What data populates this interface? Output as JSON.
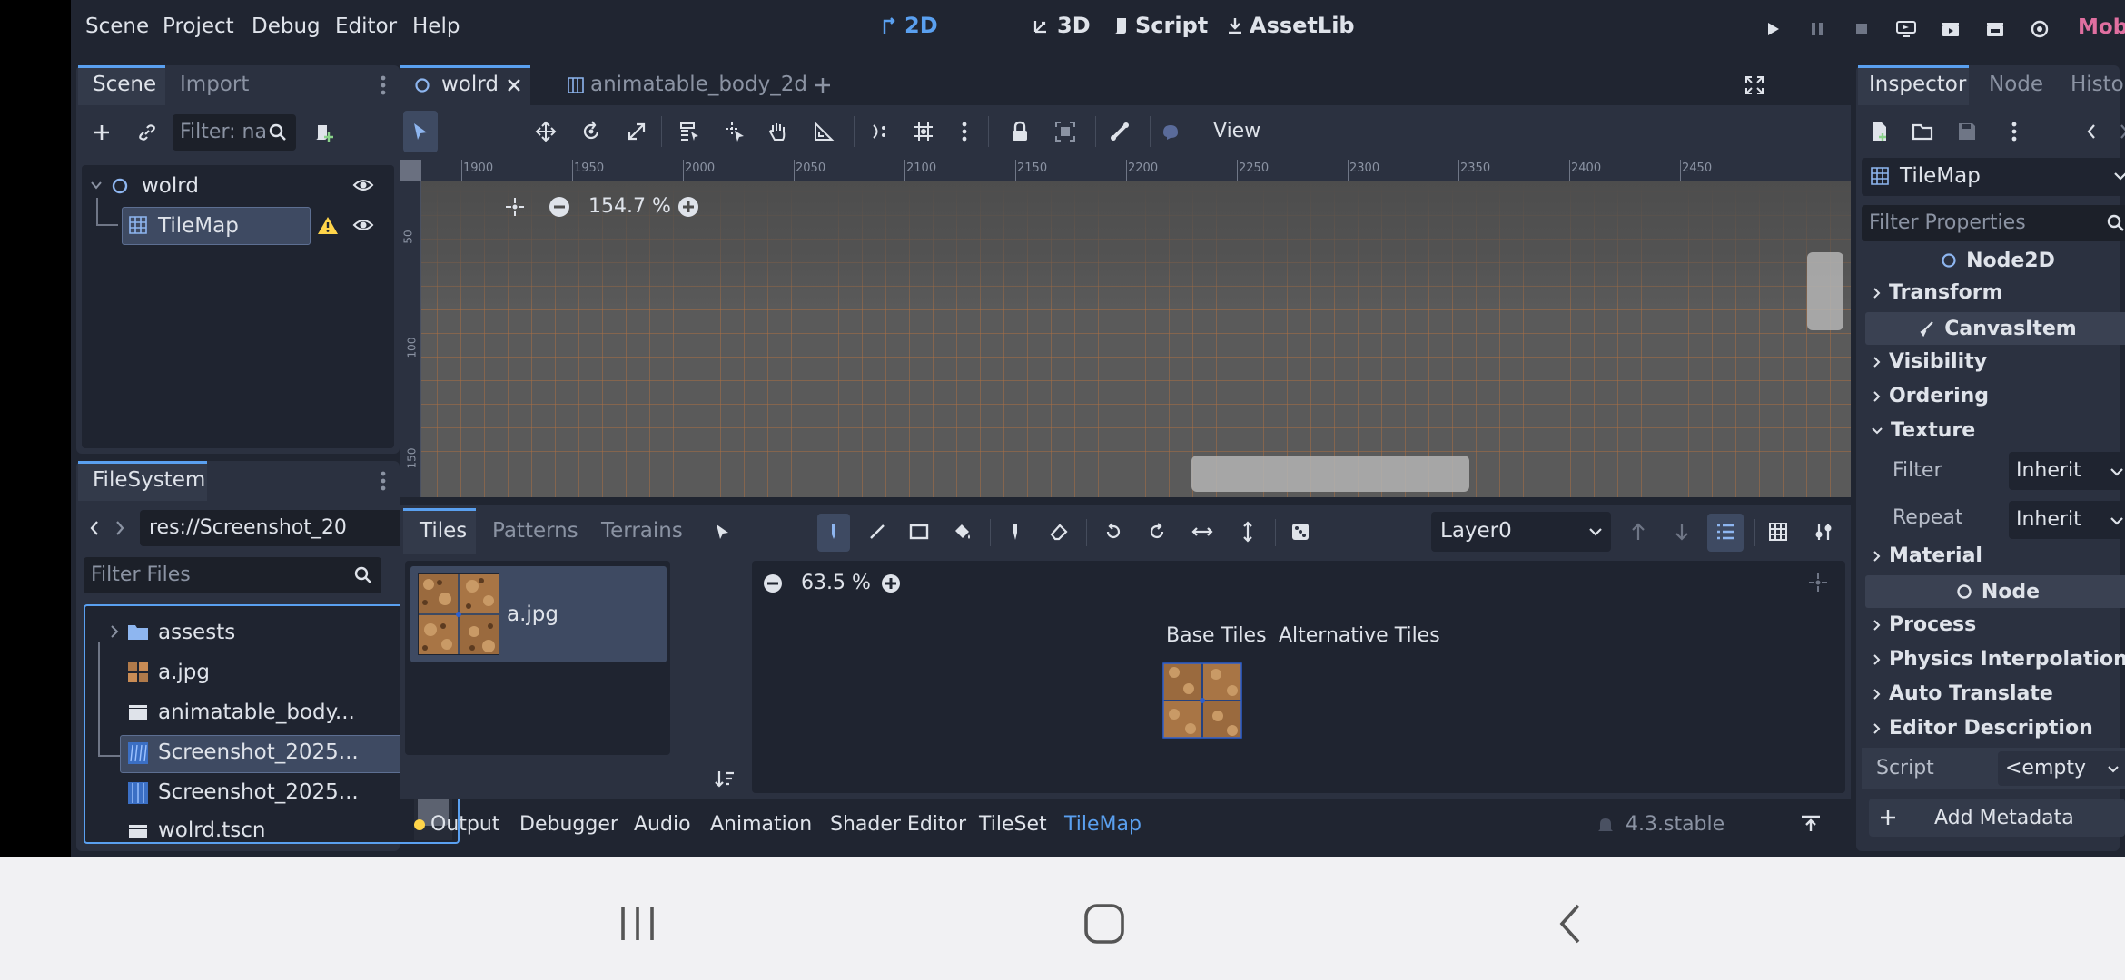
{
  "menu": [
    "Scene",
    "Project",
    "Debug",
    "Editor",
    "Help"
  ],
  "workspaces": [
    {
      "label": "2D",
      "active": true
    },
    {
      "label": "3D",
      "active": false
    },
    {
      "label": "Script",
      "active": false
    },
    {
      "label": "AssetLib",
      "active": false
    }
  ],
  "renderer": "Mobile",
  "scene_dock": {
    "tabs": [
      "Scene",
      "Import"
    ],
    "filter_placeholder": "Filter: na",
    "tree": [
      {
        "label": "wolrd",
        "type": "node2d"
      },
      {
        "label": "TileMap",
        "type": "tilemap",
        "selected": true
      }
    ]
  },
  "filesystem": {
    "title": "FileSystem",
    "path": "res://Screenshot_20",
    "filter_placeholder": "Filter Files",
    "items": [
      {
        "label": "assests",
        "kind": "folder"
      },
      {
        "label": "a.jpg",
        "kind": "image"
      },
      {
        "label": "animatable_body...",
        "kind": "scene"
      },
      {
        "label": "Screenshot_2025...",
        "kind": "screenshot",
        "selected": true
      },
      {
        "label": "Screenshot_2025...",
        "kind": "screenshot"
      },
      {
        "label": "wolrd.tscn",
        "kind": "scene"
      }
    ]
  },
  "editor_tabs": [
    {
      "label": "wolrd",
      "active": true
    },
    {
      "label": "animatable_body_2d",
      "active": false
    }
  ],
  "toolbar": {
    "view_label": "View"
  },
  "viewport": {
    "zoom": "154.7 %",
    "ruler_x": [
      "1900",
      "1950",
      "2000",
      "2050",
      "2100",
      "2150",
      "2200",
      "2250",
      "2300",
      "2350",
      "2400",
      "2450"
    ],
    "ruler_y": [
      "50",
      "100",
      "150"
    ]
  },
  "tilemap_panel": {
    "tabs": [
      "Tiles",
      "Patterns",
      "Terrains"
    ],
    "layer": "Layer0",
    "source": "a.jpg",
    "zoom": "63.5 %",
    "subtabs": [
      "Base Tiles",
      "Alternative Tiles"
    ]
  },
  "bottom_bar": {
    "tabs": [
      "Output",
      "Debugger",
      "Audio",
      "Animation",
      "Shader Editor",
      "TileSet",
      "TileMap"
    ],
    "active": "TileMap",
    "version": "4.3.stable"
  },
  "inspector": {
    "tabs": [
      "Inspector",
      "Node",
      "History"
    ],
    "object": "TileMap",
    "filter_placeholder": "Filter Properties",
    "class_node2d": "Node2D",
    "transform": "Transform",
    "class_canvasitem": "CanvasItem",
    "visibility": "Visibility",
    "ordering": "Ordering",
    "texture": "Texture",
    "filter_label": "Filter",
    "filter_value": "Inherit",
    "repeat_label": "Repeat",
    "repeat_value": "Inherit",
    "material": "Material",
    "class_node": "Node",
    "process": "Process",
    "physics_interp": "Physics Interpolation",
    "auto_translate": "Auto Translate",
    "editor_desc": "Editor Description",
    "script_label": "Script",
    "script_value": "<empty",
    "add_metadata": "Add Metadata"
  },
  "colors": {
    "accent": "#5aa0f0",
    "renderer": "#e06fa0",
    "grid": "#c8763a",
    "warning": "#ffd54a"
  }
}
